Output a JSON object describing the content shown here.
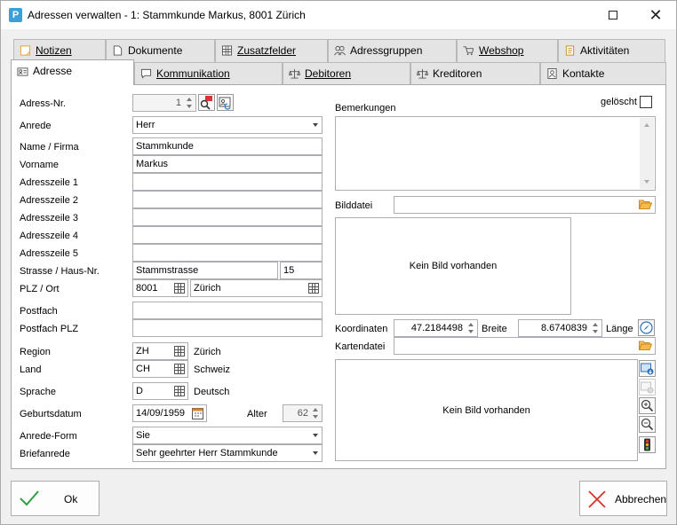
{
  "window": {
    "app_icon_letter": "P",
    "title": "Adressen verwalten - 1: Stammkunde Markus, 8001 Zürich"
  },
  "tabs_row1": [
    {
      "label": "Notizen"
    },
    {
      "label": "Dokumente"
    },
    {
      "label": "Zusatzfelder"
    },
    {
      "label": "Adressgruppen"
    },
    {
      "label": "Webshop"
    },
    {
      "label": "Aktivitäten"
    }
  ],
  "tabs_row2": [
    {
      "label": "Adresse"
    },
    {
      "label": "Kommunikation"
    },
    {
      "label": "Debitoren"
    },
    {
      "label": "Kreditoren"
    },
    {
      "label": "Kontakte"
    }
  ],
  "form": {
    "adress_nr": {
      "label": "Adress-Nr.",
      "value": "1"
    },
    "anrede": {
      "label": "Anrede",
      "value": "Herr"
    },
    "name": {
      "label": "Name / Firma",
      "value": "Stammkunde"
    },
    "vorname": {
      "label": "Vorname",
      "value": "Markus"
    },
    "adresszeile1": {
      "label": "Adresszeile 1",
      "value": ""
    },
    "adresszeile2": {
      "label": "Adresszeile 2",
      "value": ""
    },
    "adresszeile3": {
      "label": "Adresszeile 3",
      "value": ""
    },
    "adresszeile4": {
      "label": "Adresszeile 4",
      "value": ""
    },
    "adresszeile5": {
      "label": "Adresszeile 5",
      "value": ""
    },
    "strasse": {
      "label": "Strasse / Haus-Nr.",
      "value": "Stammstrasse",
      "hausnr": "15"
    },
    "plz_ort": {
      "label": "PLZ / Ort",
      "plz": "8001",
      "ort": "Zürich"
    },
    "postfach": {
      "label": "Postfach",
      "value": ""
    },
    "postfach_plz": {
      "label": "Postfach PLZ",
      "value": ""
    },
    "region": {
      "label": "Region",
      "code": "ZH",
      "name": "Zürich"
    },
    "land": {
      "label": "Land",
      "code": "CH",
      "name": "Schweiz"
    },
    "sprache": {
      "label": "Sprache",
      "code": "D",
      "name": "Deutsch"
    },
    "geburtsdatum": {
      "label": "Geburtsdatum",
      "value": "14/09/1959"
    },
    "alter": {
      "label": "Alter",
      "value": "62"
    },
    "anrede_form": {
      "label": "Anrede-Form",
      "value": "Sie"
    },
    "briefanrede": {
      "label": "Briefanrede",
      "value": "Sehr geehrter Herr Stammkunde"
    }
  },
  "right": {
    "bemerkungen_label": "Bemerkungen",
    "bemerkungen_value": "",
    "geloescht_label": "gelöscht",
    "bilddatei_label": "Bilddatei",
    "bilddatei_value": "",
    "kein_bild": "Kein Bild vorhanden",
    "koordinaten_label": "Koordinaten",
    "breite_value": "47.2184498",
    "breite_label": "Breite",
    "laenge_value": "8.6740839",
    "laenge_label": "Länge",
    "kartendatei_label": "Kartendatei",
    "kartendatei_value": "",
    "map_kein_bild": "Kein Bild vorhanden"
  },
  "buttons": {
    "ok": "Ok",
    "abbrechen": "Abbrechen"
  },
  "colors": {
    "ok_check": "#2e9e44",
    "cancel_x": "#d9322a",
    "folder": "#e8a33a",
    "app_icon": "#3aa0d8"
  }
}
